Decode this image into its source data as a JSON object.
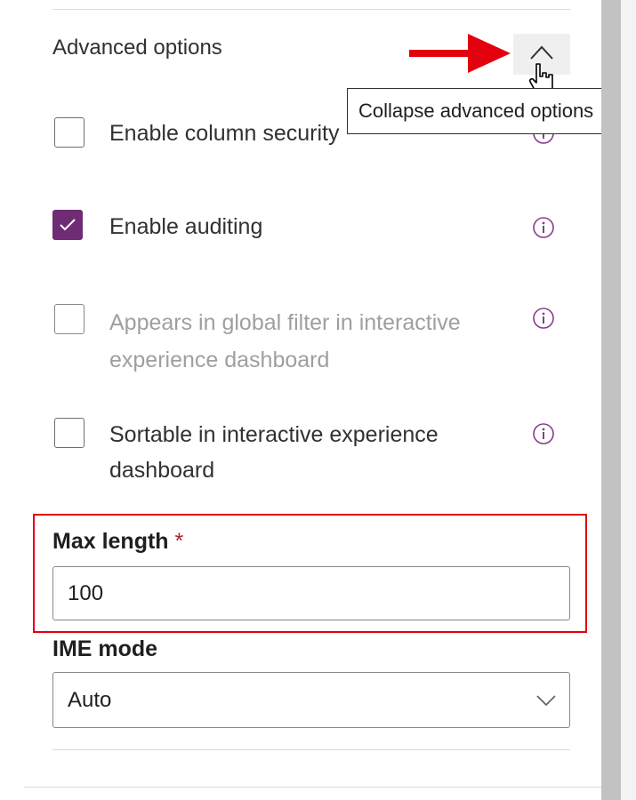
{
  "advanced": {
    "title": "Advanced options",
    "collapse_tooltip": "Collapse advanced options",
    "icons": {
      "collapse": "chevron-up-icon",
      "cursor": "hand-pointer-icon",
      "annotation": "red-arrow-icon"
    }
  },
  "options": [
    {
      "label": "Enable column security",
      "checked": false,
      "disabled": false,
      "info_icon": "info-icon"
    },
    {
      "label": "Enable auditing",
      "checked": true,
      "disabled": false,
      "info_icon": "info-icon"
    },
    {
      "label_line1": "Appears in global filter in interactive",
      "label_line2": "experience dashboard",
      "checked": false,
      "disabled": true,
      "info_icon": "info-icon"
    },
    {
      "label_line1": "Sortable in interactive experience",
      "label_line2": "dashboard",
      "checked": false,
      "disabled": false,
      "info_icon": "info-icon"
    }
  ],
  "max_length": {
    "label": "Max length",
    "required_marker": "*",
    "value": "100"
  },
  "ime_mode": {
    "label": "IME mode",
    "value": "Auto",
    "icon": "chevron-down-icon"
  },
  "colors": {
    "accent": "#6f2b74",
    "annotation_red": "#e3000f",
    "info_icon": "#8a3b8f"
  }
}
